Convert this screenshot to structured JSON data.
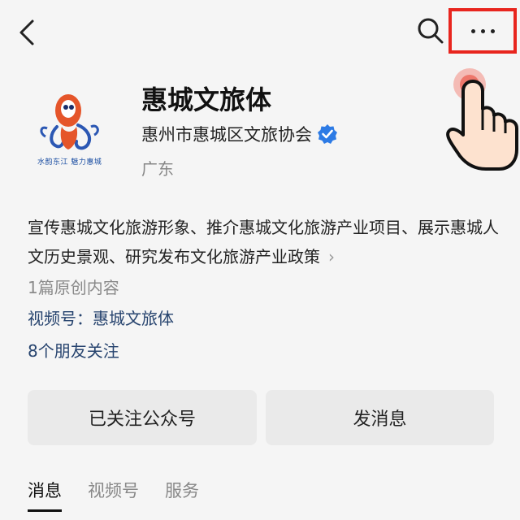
{
  "header": {
    "back_icon": "chevron-left-icon",
    "search_icon": "search-icon",
    "more_icon": "more-horizontal-icon",
    "highlight_color": "#e8251e"
  },
  "profile": {
    "logo_caption": "水韵东江 魅力惠城",
    "name": "惠城文旅体",
    "organization": "惠州市惠城区文旅协会",
    "verified_icon": "verified-badge-icon",
    "region": "广东"
  },
  "description": {
    "text": "宣传惠城文化旅游形象、推介惠城文化旅游产业项目、展示惠城人文历史景观、研究发布文化旅游产业政策",
    "chevron": "›"
  },
  "stats": {
    "original_count": "1篇原创内容",
    "video_account": "视频号：惠城文旅体",
    "friends_following": "8个朋友关注"
  },
  "actions": {
    "follow_label": "已关注公众号",
    "message_label": "发消息"
  },
  "tabs": [
    {
      "label": "消息"
    },
    {
      "label": "视频号"
    },
    {
      "label": "服务"
    }
  ]
}
